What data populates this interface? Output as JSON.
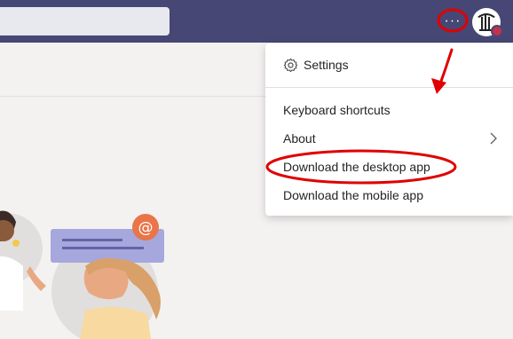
{
  "topbar": {
    "more_label": "···",
    "more_icon": "more-horizontal-icon",
    "avatar_icon": "org-logo-icon",
    "bg_color": "#464775"
  },
  "menu": {
    "settings_label": "Settings",
    "settings_icon": "gear-icon",
    "items": [
      {
        "label": "Keyboard shortcuts"
      },
      {
        "label": "About",
        "icon": "chevron-right-icon"
      },
      {
        "label": "Download the desktop app"
      },
      {
        "label": "Download the mobile app"
      }
    ]
  },
  "annotations": {
    "color": "#e00000"
  },
  "illustration": {
    "mention_badge": "@"
  }
}
